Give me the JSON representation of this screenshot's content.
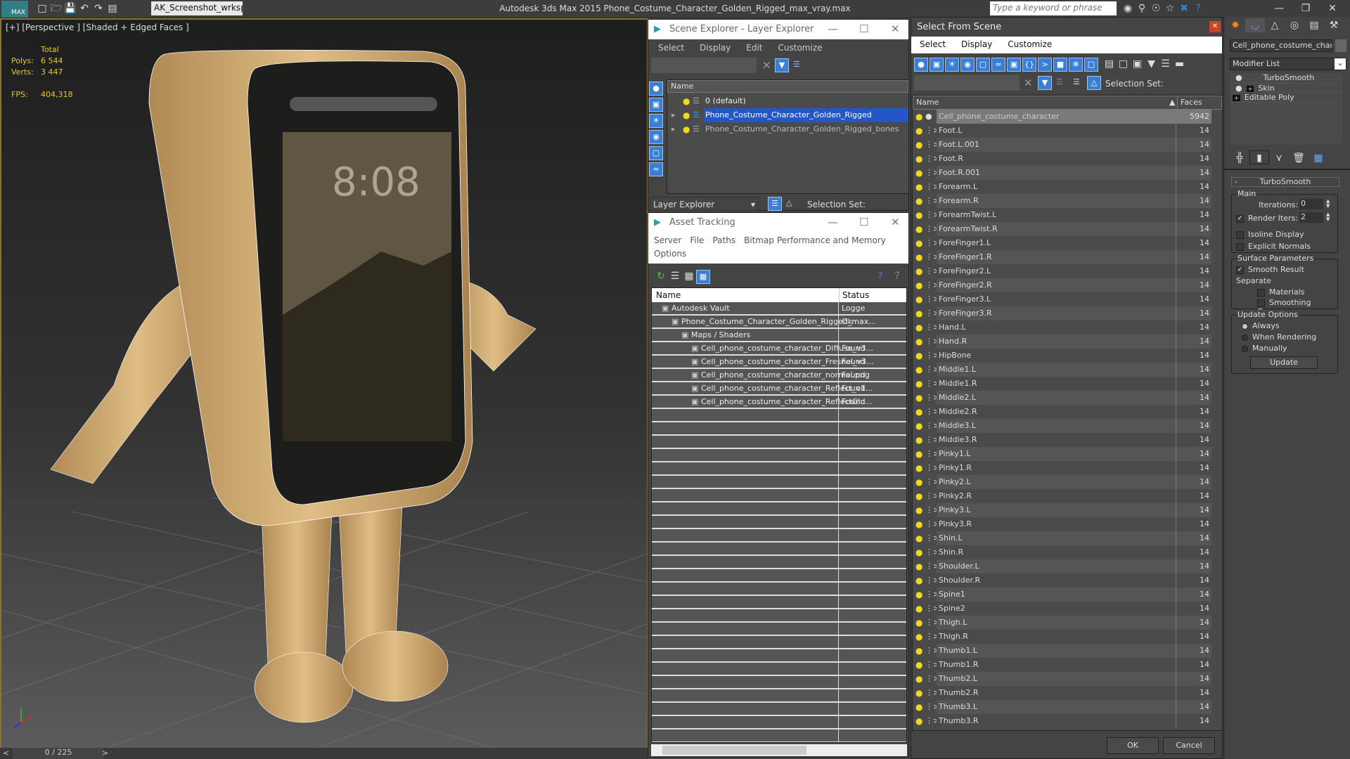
{
  "app": {
    "logo": "MAX",
    "workspace": "AK_Screenshot_wrksp",
    "title": "Autodesk 3ds Max  2015    Phone_Costume_Character_Golden_Rigged_max_vray.max",
    "search_placeholder": "Type a keyword or phrase"
  },
  "viewport": {
    "label": "[+] [Perspective ] [Shaded + Edged Faces ]",
    "stats": {
      "total_label": "Total",
      "polys_label": "Polys:",
      "polys": "6 544",
      "verts_label": "Verts:",
      "verts": "3 447",
      "fps_label": "FPS:",
      "fps": "404,318"
    },
    "timeline": "0 / 225",
    "prev": "<",
    "next": ">"
  },
  "scene_explorer": {
    "title": "Scene Explorer - Layer Explorer",
    "menu": [
      "Select",
      "Display",
      "Edit",
      "Customize"
    ],
    "column": "Name",
    "layers": [
      {
        "name": "0 (default)",
        "selected": false
      },
      {
        "name": "Phone_Costume_Character_Golden_Rigged",
        "selected": true
      },
      {
        "name": "Phone_Costume_Character_Golden_Rigged_bones",
        "selected": false
      }
    ],
    "footer_dropdown": "Layer Explorer",
    "selection_set": "Selection Set:"
  },
  "asset_tracking": {
    "title": "Asset Tracking",
    "menu": [
      "Server",
      "File",
      "Paths",
      "Bitmap Performance and Memory",
      "Options"
    ],
    "columns": [
      "Name",
      "Status"
    ],
    "rows": [
      {
        "name": "Autodesk Vault",
        "status": "Logge",
        "indent": 1
      },
      {
        "name": "Phone_Costume_Character_Golden_Rigged_max...",
        "status": "Ok",
        "indent": 2
      },
      {
        "name": "Maps / Shaders",
        "status": "",
        "indent": 3
      },
      {
        "name": "Cell_phone_costume_character_Diffuse_v3...",
        "status": "Found",
        "indent": 4
      },
      {
        "name": "Cell_phone_costume_character_Fresnel_v3...",
        "status": "Found",
        "indent": 4
      },
      {
        "name": "Cell_phone_costume_character_normal.png",
        "status": "Found",
        "indent": 4
      },
      {
        "name": "Cell_phone_costume_character_Reflect_v1...",
        "status": "Found",
        "indent": 4
      },
      {
        "name": "Cell_phone_costume_character_ReflectGlo...",
        "status": "Found",
        "indent": 4
      }
    ]
  },
  "select_from_scene": {
    "title": "Select From Scene",
    "menu": [
      "Select",
      "Display",
      "Customize"
    ],
    "selection_set": "Selection Set:",
    "columns": [
      "Name",
      "Faces"
    ],
    "objects": [
      [
        "Cell_phone_costume_character",
        "5942"
      ],
      [
        "Foot.L",
        "14"
      ],
      [
        "Foot.L.001",
        "14"
      ],
      [
        "Foot.R",
        "14"
      ],
      [
        "Foot.R.001",
        "14"
      ],
      [
        "Forearm.L",
        "14"
      ],
      [
        "Forearm.R",
        "14"
      ],
      [
        "ForearmTwist.L",
        "14"
      ],
      [
        "ForearmTwist.R",
        "14"
      ],
      [
        "ForeFinger1.L",
        "14"
      ],
      [
        "ForeFinger1.R",
        "14"
      ],
      [
        "ForeFinger2.L",
        "14"
      ],
      [
        "ForeFinger2.R",
        "14"
      ],
      [
        "ForeFinger3.L",
        "14"
      ],
      [
        "ForeFinger3.R",
        "14"
      ],
      [
        "Hand.L",
        "14"
      ],
      [
        "Hand.R",
        "14"
      ],
      [
        "HipBone",
        "14"
      ],
      [
        "Middle1.L",
        "14"
      ],
      [
        "Middle1.R",
        "14"
      ],
      [
        "Middle2.L",
        "14"
      ],
      [
        "Middle2.R",
        "14"
      ],
      [
        "Middle3.L",
        "14"
      ],
      [
        "Middle3.R",
        "14"
      ],
      [
        "Pinky1.L",
        "14"
      ],
      [
        "Pinky1.R",
        "14"
      ],
      [
        "Pinky2.L",
        "14"
      ],
      [
        "Pinky2.R",
        "14"
      ],
      [
        "Pinky3.L",
        "14"
      ],
      [
        "Pinky3.R",
        "14"
      ],
      [
        "Shin.L",
        "14"
      ],
      [
        "Shin.R",
        "14"
      ],
      [
        "Shoulder.L",
        "14"
      ],
      [
        "Shoulder.R",
        "14"
      ],
      [
        "Spine1",
        "14"
      ],
      [
        "Spine2",
        "14"
      ],
      [
        "Thigh.L",
        "14"
      ],
      [
        "Thigh.R",
        "14"
      ],
      [
        "Thumb1.L",
        "14"
      ],
      [
        "Thumb1.R",
        "14"
      ],
      [
        "Thumb2.L",
        "14"
      ],
      [
        "Thumb2.R",
        "14"
      ],
      [
        "Thumb3.L",
        "14"
      ],
      [
        "Thumb3.R",
        "14"
      ]
    ],
    "ok": "OK",
    "cancel": "Cancel"
  },
  "command_panel": {
    "object_name": "Cell_phone_costume_charact",
    "modifier_list": "Modifier List",
    "stack": [
      "TurboSmooth",
      "Skin",
      "Editable Poly"
    ],
    "rollout": {
      "title": "TurboSmooth",
      "collapse": "-",
      "main": "Main",
      "iterations_label": "Iterations:",
      "iterations": "0",
      "render_iters_label": "Render Iters:",
      "render_iters": "2",
      "render_iters_checked": true,
      "isoline": "Isoline Display",
      "explicit_normals": "Explicit Normals",
      "surface": "Surface Parameters",
      "smooth_result": "Smooth Result",
      "separate": "Separate",
      "materials": "Materials",
      "smoothing_groups": "Smoothing Groups",
      "update_options": "Update Options",
      "always": "Always",
      "when_rendering": "When Rendering",
      "manually": "Manually",
      "update": "Update"
    }
  },
  "colors": {
    "accent": "#3b7fd4",
    "selection": "#2456c8",
    "stats": "#e8c820",
    "viewport_border": "#8a7235",
    "character": "#d8b47c"
  }
}
